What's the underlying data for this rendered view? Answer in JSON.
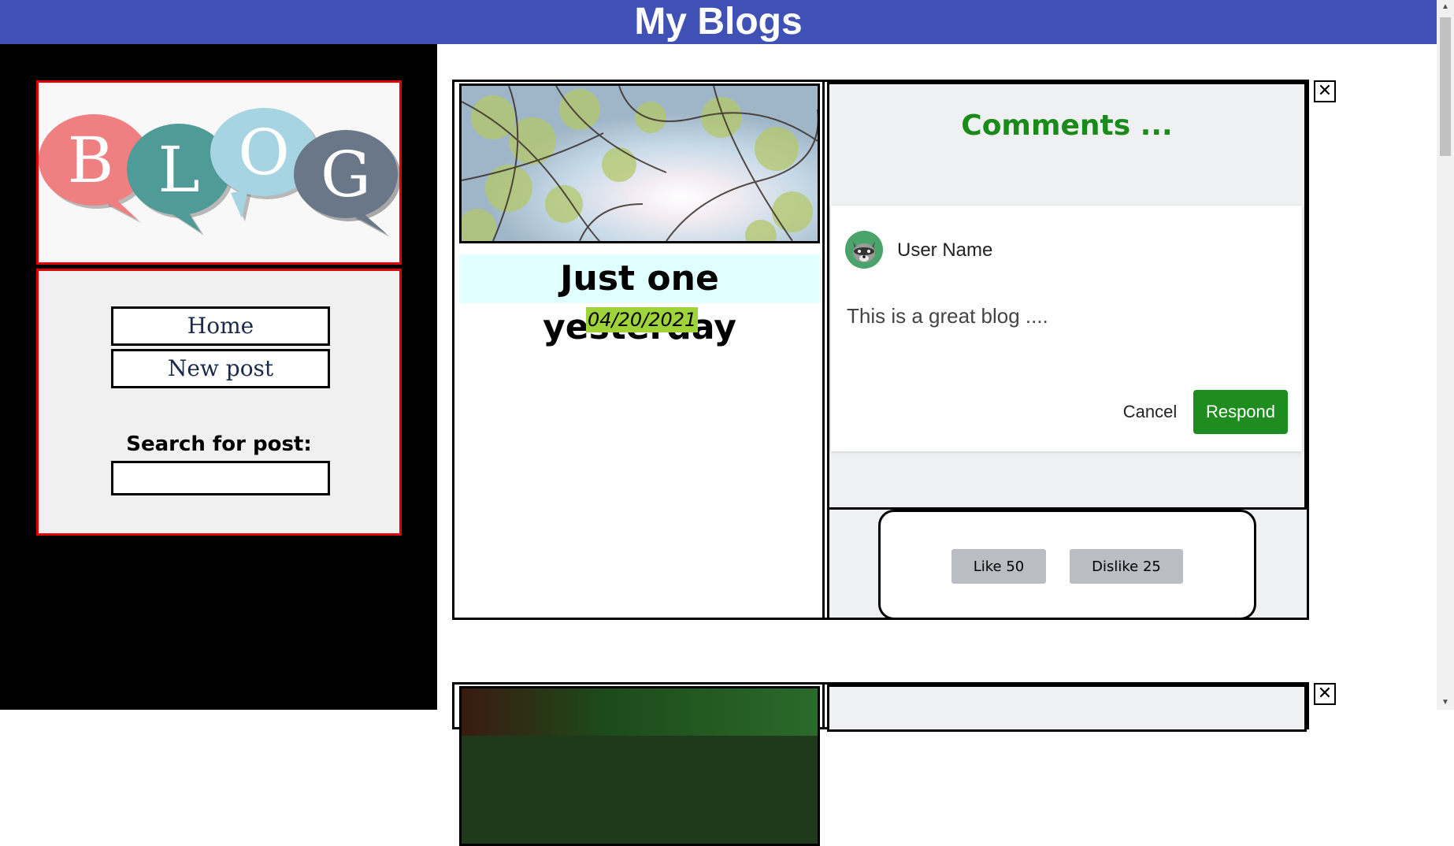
{
  "header": {
    "title": "My Blogs"
  },
  "sidebar": {
    "logo": {
      "letters": [
        "B",
        "L",
        "O",
        "G"
      ],
      "colors": [
        "#ef7f80",
        "#4f9b98",
        "#a6d4e3",
        "#697788"
      ]
    },
    "nav": [
      {
        "label": "Home"
      },
      {
        "label": "New post"
      }
    ],
    "search": {
      "label": "Search for post:",
      "value": "",
      "placeholder": ""
    }
  },
  "posts": [
    {
      "title": "Just one yesterday",
      "date": "04/20/2021",
      "comments": {
        "title": "Comments ...",
        "user_name": "User Name",
        "text": "This is a great blog ....",
        "cancel_label": "Cancel",
        "respond_label": "Respond"
      },
      "like_label": "Like 50",
      "dislike_label": "Dislike 25",
      "close_label": "✕"
    },
    {
      "close_label": "✕"
    }
  ],
  "colors": {
    "header": "#3f51b5",
    "comment_title": "#1a8a1a",
    "respond": "#1e8c1e",
    "date_highlight": "#9ed33b",
    "title_highlight": "#e0ffff",
    "sidebar_border": "#e00000"
  },
  "icons": {
    "close": "close-icon",
    "avatar": "raccoon-avatar-icon",
    "scroll_up": "scroll-up-arrow-icon",
    "scroll_down": "scroll-down-arrow-icon"
  }
}
